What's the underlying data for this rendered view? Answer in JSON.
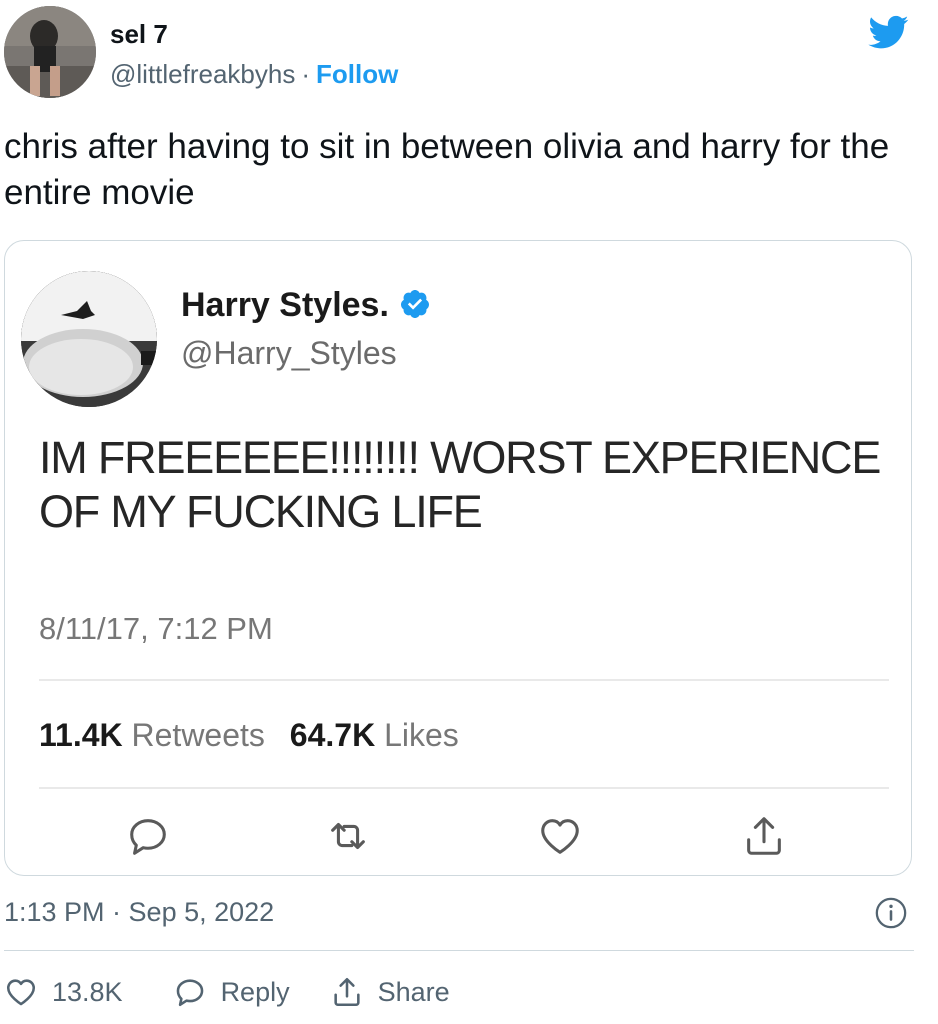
{
  "author": {
    "name": "sel 7",
    "handle": "@littlefreakbyhs",
    "separator": "·",
    "follow_label": "Follow"
  },
  "tweet": {
    "text": "chris after having to sit in between olivia and harry for the entire movie",
    "timestamp": "1:13 PM · Sep 5, 2022"
  },
  "embedded": {
    "name": "Harry Styles.",
    "handle": "@Harry_Styles",
    "text": "IM FREEEEEE!!!!!!!! WORST EXPERIENCE OF MY FUCKING LIFE",
    "timestamp": "8/11/17, 7:12 PM",
    "retweets_count": "11.4K",
    "retweets_label": "Retweets",
    "likes_count": "64.7K",
    "likes_label": "Likes"
  },
  "actions": {
    "likes_count": "13.8K",
    "reply_label": "Reply",
    "share_label": "Share"
  },
  "icons": {
    "brand": "twitter-bird-icon",
    "verified": "verified-badge-icon",
    "info": "info-icon",
    "reply": "reply-icon",
    "retweet": "retweet-icon",
    "like": "heart-icon",
    "share": "share-icon"
  },
  "colors": {
    "brand_blue": "#1d9bf0",
    "text_primary": "#0f1419",
    "text_secondary": "#536471",
    "border": "#cfd9de"
  }
}
